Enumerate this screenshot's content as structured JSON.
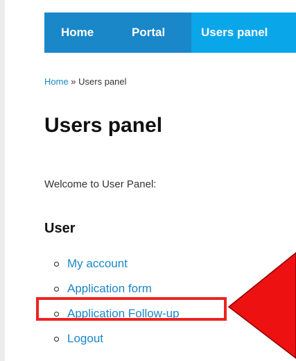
{
  "nav": {
    "items": [
      {
        "label": "Home"
      },
      {
        "label": "Portal"
      },
      {
        "label": "Users panel"
      }
    ]
  },
  "breadcrumb": {
    "home": "Home",
    "separator": " » ",
    "current": "Users panel"
  },
  "page": {
    "title": "Users panel",
    "welcome": "Welcome to User Panel:"
  },
  "user_section": {
    "heading": "User",
    "items": [
      {
        "label": "My account"
      },
      {
        "label": "Application form"
      },
      {
        "label": "Application Follow-up"
      },
      {
        "label": "Logout"
      }
    ]
  },
  "annotation": {
    "highlight_color": "#ee2222",
    "arrow_color": "#ee1111",
    "highlighted_item": "Application Follow-up"
  },
  "colors": {
    "nav_bg": "#1a87c9",
    "nav_active_bg": "#0aa6ea",
    "link": "#1a87c9"
  }
}
